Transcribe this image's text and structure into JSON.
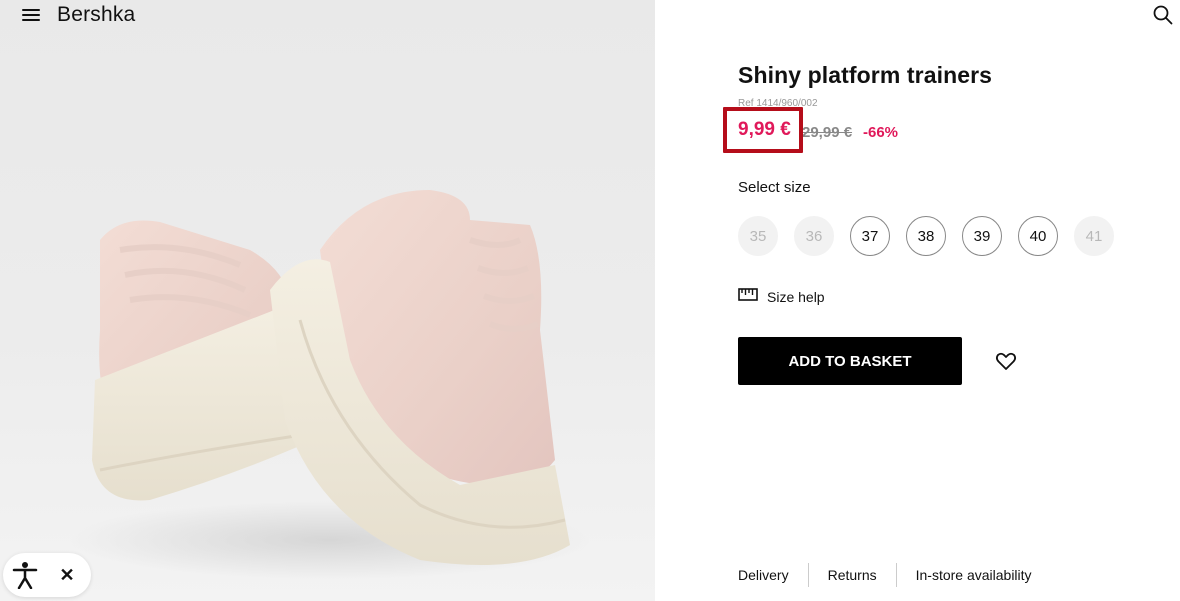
{
  "header": {
    "logo": "Bershka",
    "menu_icon": "hamburger-menu-icon",
    "search_icon": "search-icon"
  },
  "product": {
    "title": "Shiny platform trainers",
    "ref": "Ref 1414/960/002",
    "price_current": "9,99 €",
    "price_old": "29,99 €",
    "discount": "-66%",
    "price_color": "#e0195a",
    "highlight_color": "#b50d1a"
  },
  "sizes": {
    "label": "Select size",
    "options": [
      {
        "label": "35",
        "available": false
      },
      {
        "label": "36",
        "available": false
      },
      {
        "label": "37",
        "available": true
      },
      {
        "label": "38",
        "available": true
      },
      {
        "label": "39",
        "available": true
      },
      {
        "label": "40",
        "available": true
      },
      {
        "label": "41",
        "available": false
      }
    ]
  },
  "size_help": {
    "label": "Size help",
    "icon": "ruler-icon"
  },
  "actions": {
    "add_to_basket": "ADD TO BASKET",
    "wishlist_icon": "heart-icon"
  },
  "footer": {
    "links": [
      "Delivery",
      "Returns",
      "In-store availability"
    ]
  },
  "accessibility": {
    "icon": "accessibility-icon",
    "close": "✕"
  }
}
